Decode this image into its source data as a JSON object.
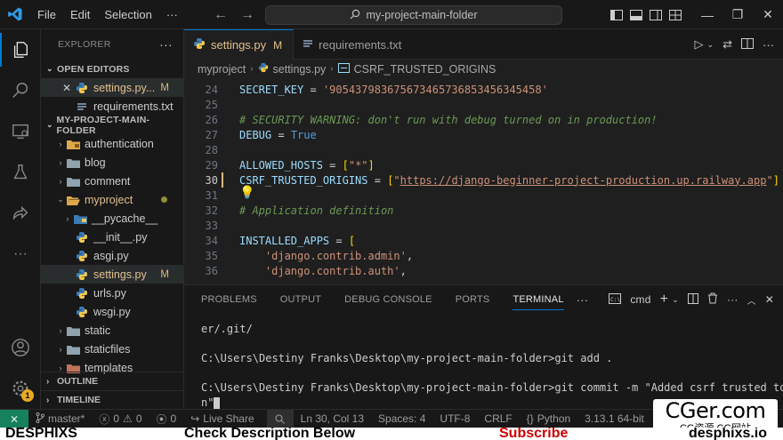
{
  "titlebar": {
    "menu": [
      "File",
      "Edit",
      "Selection"
    ],
    "search_text": "my-project-main-folder",
    "more_menu": "···"
  },
  "explorer": {
    "header": "EXPLORER",
    "open_editors_label": "OPEN EDITORS",
    "open_editor_file": "settings.py...",
    "open_editor_mark": "M",
    "open_editor_file2": "requirements.txt",
    "folder_label": "MY-PROJECT-MAIN-FOLDER",
    "tree": {
      "authentication": "authentication",
      "blog": "blog",
      "comment": "comment",
      "myproject": "myproject",
      "pycache": "__pycache__",
      "init": "__init__.py",
      "asgi": "asgi.py",
      "settings": "settings.py",
      "settings_mark": "M",
      "urls": "urls.py",
      "wsgi": "wsgi.py",
      "static": "static",
      "staticfiles": "staticfiles",
      "templates": "templates"
    },
    "outline_label": "OUTLINE",
    "timeline_label": "TIMELINE"
  },
  "tabs": [
    {
      "label": "settings.py",
      "mark": "M"
    },
    {
      "label": "requirements.txt"
    }
  ],
  "breadcrumb": [
    "myproject",
    "settings.py",
    "CSRF_TRUSTED_ORIGINS"
  ],
  "code": {
    "lines": [
      "24",
      "25",
      "26",
      "27",
      "28",
      "29",
      "30",
      "31",
      "32",
      "33",
      "34",
      "35",
      "36"
    ],
    "l24_var": "SECRET_KEY",
    "l24_val": "'905437983675673465736853456345458'",
    "l26": "# SECURITY WARNING: don't run with debug turned on in production!",
    "l27_var": "DEBUG",
    "l27_val": "True",
    "l29_var": "ALLOWED_HOSTS",
    "l29_val": "\"*\"",
    "l30_var": "CSRF_TRUSTED_ORIGINS",
    "l30_val": "https://django-beginner-project-production.up.railway.app",
    "l32": "# Application definition",
    "l34_var": "INSTALLED_APPS",
    "l35": "'django.contrib.admin'",
    "l36": "'django.contrib.auth'"
  },
  "panel": {
    "tabs": [
      "PROBLEMS",
      "OUTPUT",
      "DEBUG CONSOLE",
      "PORTS",
      "TERMINAL"
    ],
    "more": "···",
    "shell": "cmd",
    "terminal": {
      "l1": "er/.git/",
      "l2": "",
      "l3": "C:\\Users\\Destiny Franks\\Desktop\\my-project-main-folder>git add .",
      "l4": "",
      "l5": "C:\\Users\\Destiny Franks\\Desktop\\my-project-main-folder>git commit -m \"Added csrf trusted toke",
      "l6": "n\""
    }
  },
  "status": {
    "branch": "master*",
    "errors": "0",
    "warnings": "0",
    "ports": "0",
    "live_share": "Live Share",
    "position": "Ln 30, Col 13",
    "spaces": "Spaces: 4",
    "encoding": "UTF-8",
    "eol": "CRLF",
    "language": "Python",
    "interpreter": "3.13.1 64-bit"
  },
  "watermark": {
    "title": "CGer.com",
    "subtitle": "CG资源 CG网站"
  },
  "footer": {
    "left": "DESPHIXS",
    "center": "Check Description Below",
    "subscribe": "Subscribe",
    "right": "desphixs.io"
  },
  "colors": {
    "accent": "#0078d4",
    "remote": "#16825d",
    "modified": "#e2c08d",
    "subscribe": "#cc0000"
  },
  "activity_badge": "1"
}
